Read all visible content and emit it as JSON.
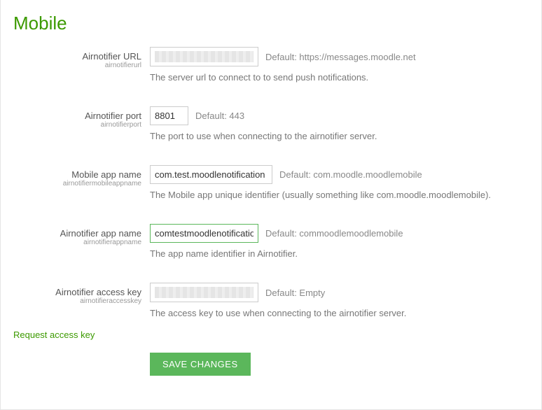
{
  "title": "Mobile",
  "fields": {
    "url": {
      "label": "Airnotifier URL",
      "name": "airnotifierurl",
      "default": "Default: https://messages.moodle.net",
      "desc": "The server url to connect to to send push notifications."
    },
    "port": {
      "label": "Airnotifier port",
      "name": "airnotifierport",
      "value": "8801",
      "default": "Default: 443",
      "desc": "The port to use when connecting to the airnotifier server."
    },
    "mobileapp": {
      "label": "Mobile app name",
      "name": "airnotifiermobileappname",
      "value": "com.test.moodlenotification",
      "default": "Default: com.moodle.moodlemobile",
      "desc": "The Mobile app unique identifier (usually something like com.moodle.moodlemobile)."
    },
    "appname": {
      "label": "Airnotifier app name",
      "name": "airnotifierappname",
      "value": "comtestmoodlenotification",
      "default": "Default: commoodlemoodlemobile",
      "desc": "The app name identifier in Airnotifier."
    },
    "accesskey": {
      "label": "Airnotifier access key",
      "name": "airnotifieraccesskey",
      "default": "Default: Empty",
      "desc": "The access key to use when connecting to the airnotifier server."
    }
  },
  "request_link": "Request access key",
  "save_label": "SAVE CHANGES"
}
